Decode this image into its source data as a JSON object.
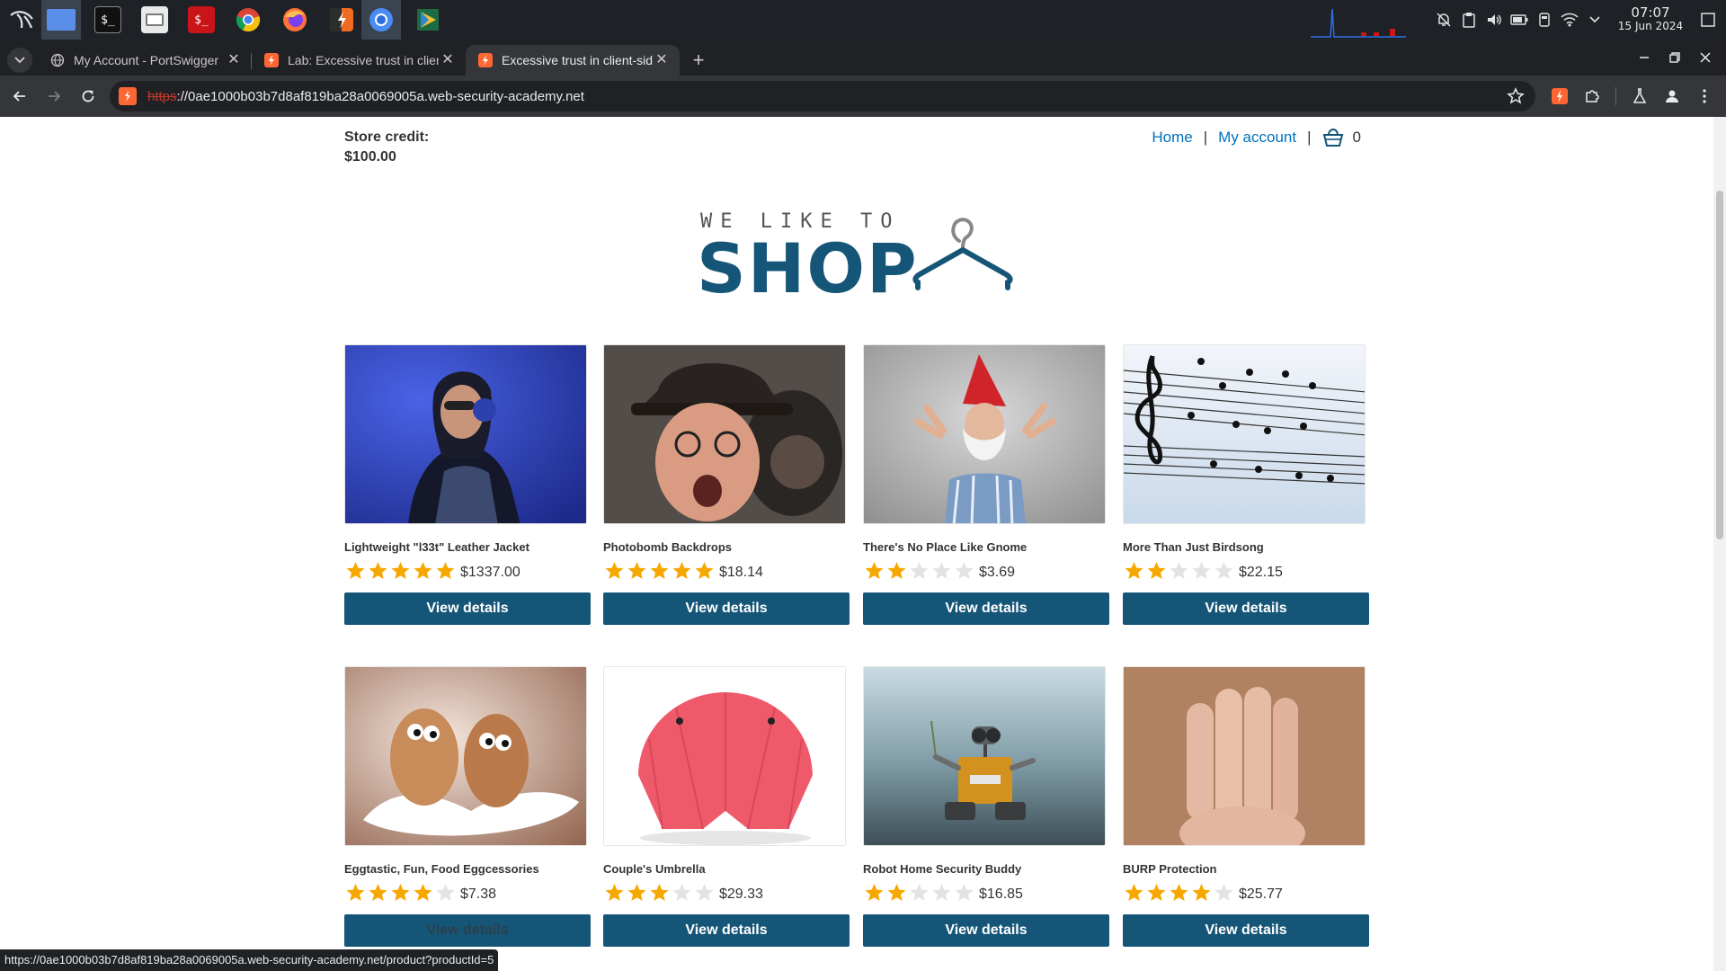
{
  "os": {
    "taskbar_apps": [
      {
        "name": "kali-menu-icon"
      },
      {
        "name": "workspace-icon"
      },
      {
        "name": "terminal-icon"
      },
      {
        "name": "files-icon"
      },
      {
        "name": "terminal-root-icon"
      },
      {
        "name": "chrome-icon"
      },
      {
        "name": "firefox-icon"
      },
      {
        "name": "burpsuite-icon"
      },
      {
        "name": "chromium-icon"
      },
      {
        "name": "vpn-app-icon"
      }
    ],
    "clock": {
      "time": "07:07",
      "date": "15 Jun 2024"
    }
  },
  "browser": {
    "tabs": [
      {
        "title": "My Account - PortSwigger",
        "active": false
      },
      {
        "title": "Lab: Excessive trust in client-",
        "active": false
      },
      {
        "title": "Excessive trust in client-side",
        "active": true
      }
    ],
    "close_glyph": "✕",
    "new_tab_glyph": "+",
    "url_scheme": "https",
    "url_host": "://0ae1000b03b7d8af819ba28a0069005a.web-security-academy.net",
    "status_url": "https://0ae1000b03b7d8af819ba28a0069005a.web-security-academy.net/product?productId=5"
  },
  "page": {
    "store_credit_label": "Store credit:",
    "store_credit_value": "$100.00",
    "nav": {
      "home": "Home",
      "sep": "|",
      "my_account": "My account",
      "cart_count": "0"
    },
    "logo": {
      "small": "WE LIKE TO",
      "big": "SHOP"
    },
    "products": [
      {
        "name": "Lightweight \"l33t\" Leather Jacket",
        "rating": 5,
        "price": "$1337.00",
        "button": "View details",
        "image": "jacket"
      },
      {
        "name": "Photobomb Backdrops",
        "rating": 5,
        "price": "$18.14",
        "button": "View details",
        "image": "photobomb"
      },
      {
        "name": "There's No Place Like Gnome",
        "rating": 2,
        "price": "$3.69",
        "button": "View details",
        "image": "gnome"
      },
      {
        "name": "More Than Just Birdsong",
        "rating": 2,
        "price": "$22.15",
        "button": "View details",
        "image": "birdsong"
      },
      {
        "name": "Eggtastic, Fun, Food Eggcessories",
        "rating": 4,
        "price": "$7.38",
        "button": "View details",
        "image": "eggs"
      },
      {
        "name": "Couple's Umbrella",
        "rating": 3,
        "price": "$29.33",
        "button": "View details",
        "image": "umbrella"
      },
      {
        "name": "Robot Home Security Buddy",
        "rating": 2,
        "price": "$16.85",
        "button": "View details",
        "image": "robot"
      },
      {
        "name": "BURP Protection",
        "rating": 4,
        "price": "$25.77",
        "button": "View details",
        "image": "burp"
      }
    ]
  },
  "colors": {
    "brand": "#155678",
    "link": "#0071bc",
    "star_on": "#f7a800",
    "star_off": "#e3e3e3"
  }
}
